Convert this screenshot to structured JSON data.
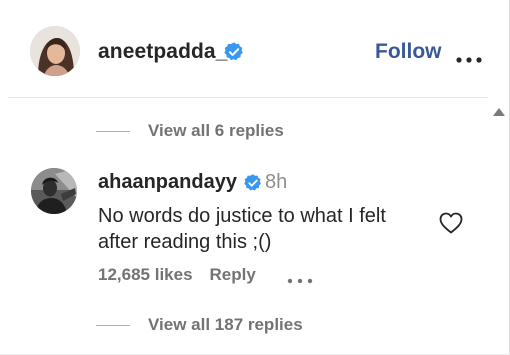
{
  "post_header": {
    "username": "aneetpadda_",
    "follow_label": "Follow",
    "more_icon": "more-horizontal-icon",
    "verified_icon": "verified-badge-icon"
  },
  "replies_top": {
    "label": "View all 6 replies"
  },
  "comment": {
    "username": "ahaanpandayy",
    "time": "8h",
    "text": "No words do justice to what I felt after reading this ;()",
    "likes": "12,685 likes",
    "reply_label": "Reply",
    "like_icon": "heart-icon",
    "more_icon": "more-horizontal-icon"
  },
  "replies_bottom": {
    "label": "View all 187 replies"
  },
  "colors": {
    "link": "#385898",
    "verified": "#3897f0",
    "muted": "#737373",
    "text": "#262626"
  }
}
